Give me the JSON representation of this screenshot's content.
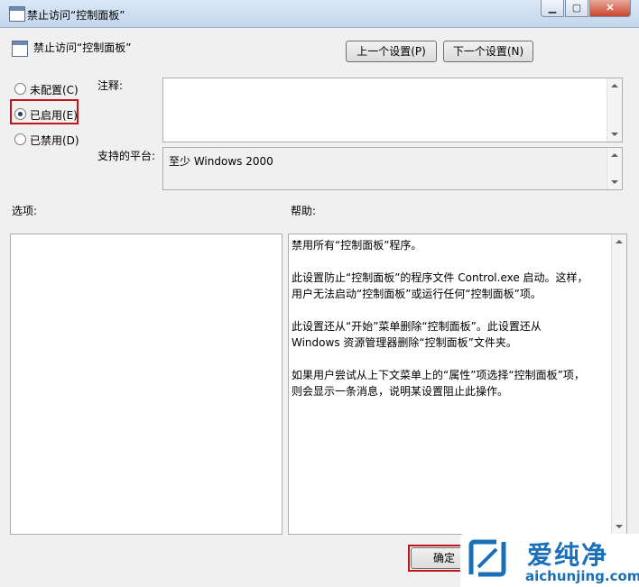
{
  "window": {
    "title": "禁止访问“控制面板”",
    "min_glyph": "▁",
    "max_glyph": "▢",
    "close_glyph": "✕"
  },
  "header": {
    "title": "禁止访问“控制面板”",
    "prev_button": "上一个设置(P)",
    "next_button": "下一个设置(N)"
  },
  "state": {
    "options": [
      {
        "label": "未配置(C)",
        "checked": false
      },
      {
        "label": "已启用(E)",
        "checked": true
      },
      {
        "label": "已禁用(D)",
        "checked": false
      }
    ]
  },
  "comment": {
    "label": "注释:",
    "value": ""
  },
  "platform": {
    "label": "支持的平台:",
    "value": "至少 Windows 2000"
  },
  "options_panel": {
    "label": "选项:"
  },
  "help_panel": {
    "label": "帮助:",
    "paragraphs": [
      "禁用所有“控制面板”程序。",
      "此设置防止“控制面板”的程序文件 Control.exe 启动。这样，\n用户无法启动“控制面板”或运行任何“控制面板”项。",
      "此设置还从“开始”菜单删除“控制面板”。此设置还从\nWindows 资源管理器删除“控制面板”文件夹。",
      "如果用户尝试从上下文菜单上的“属性”项选择“控制面板”项，\n则会显示一条消息，说明某设置阻止此操作。"
    ]
  },
  "footer": {
    "ok_button": "确定"
  },
  "watermark": {
    "name": "爱纯净",
    "url": "aichunjing.com",
    "color": "#1a70b8"
  }
}
